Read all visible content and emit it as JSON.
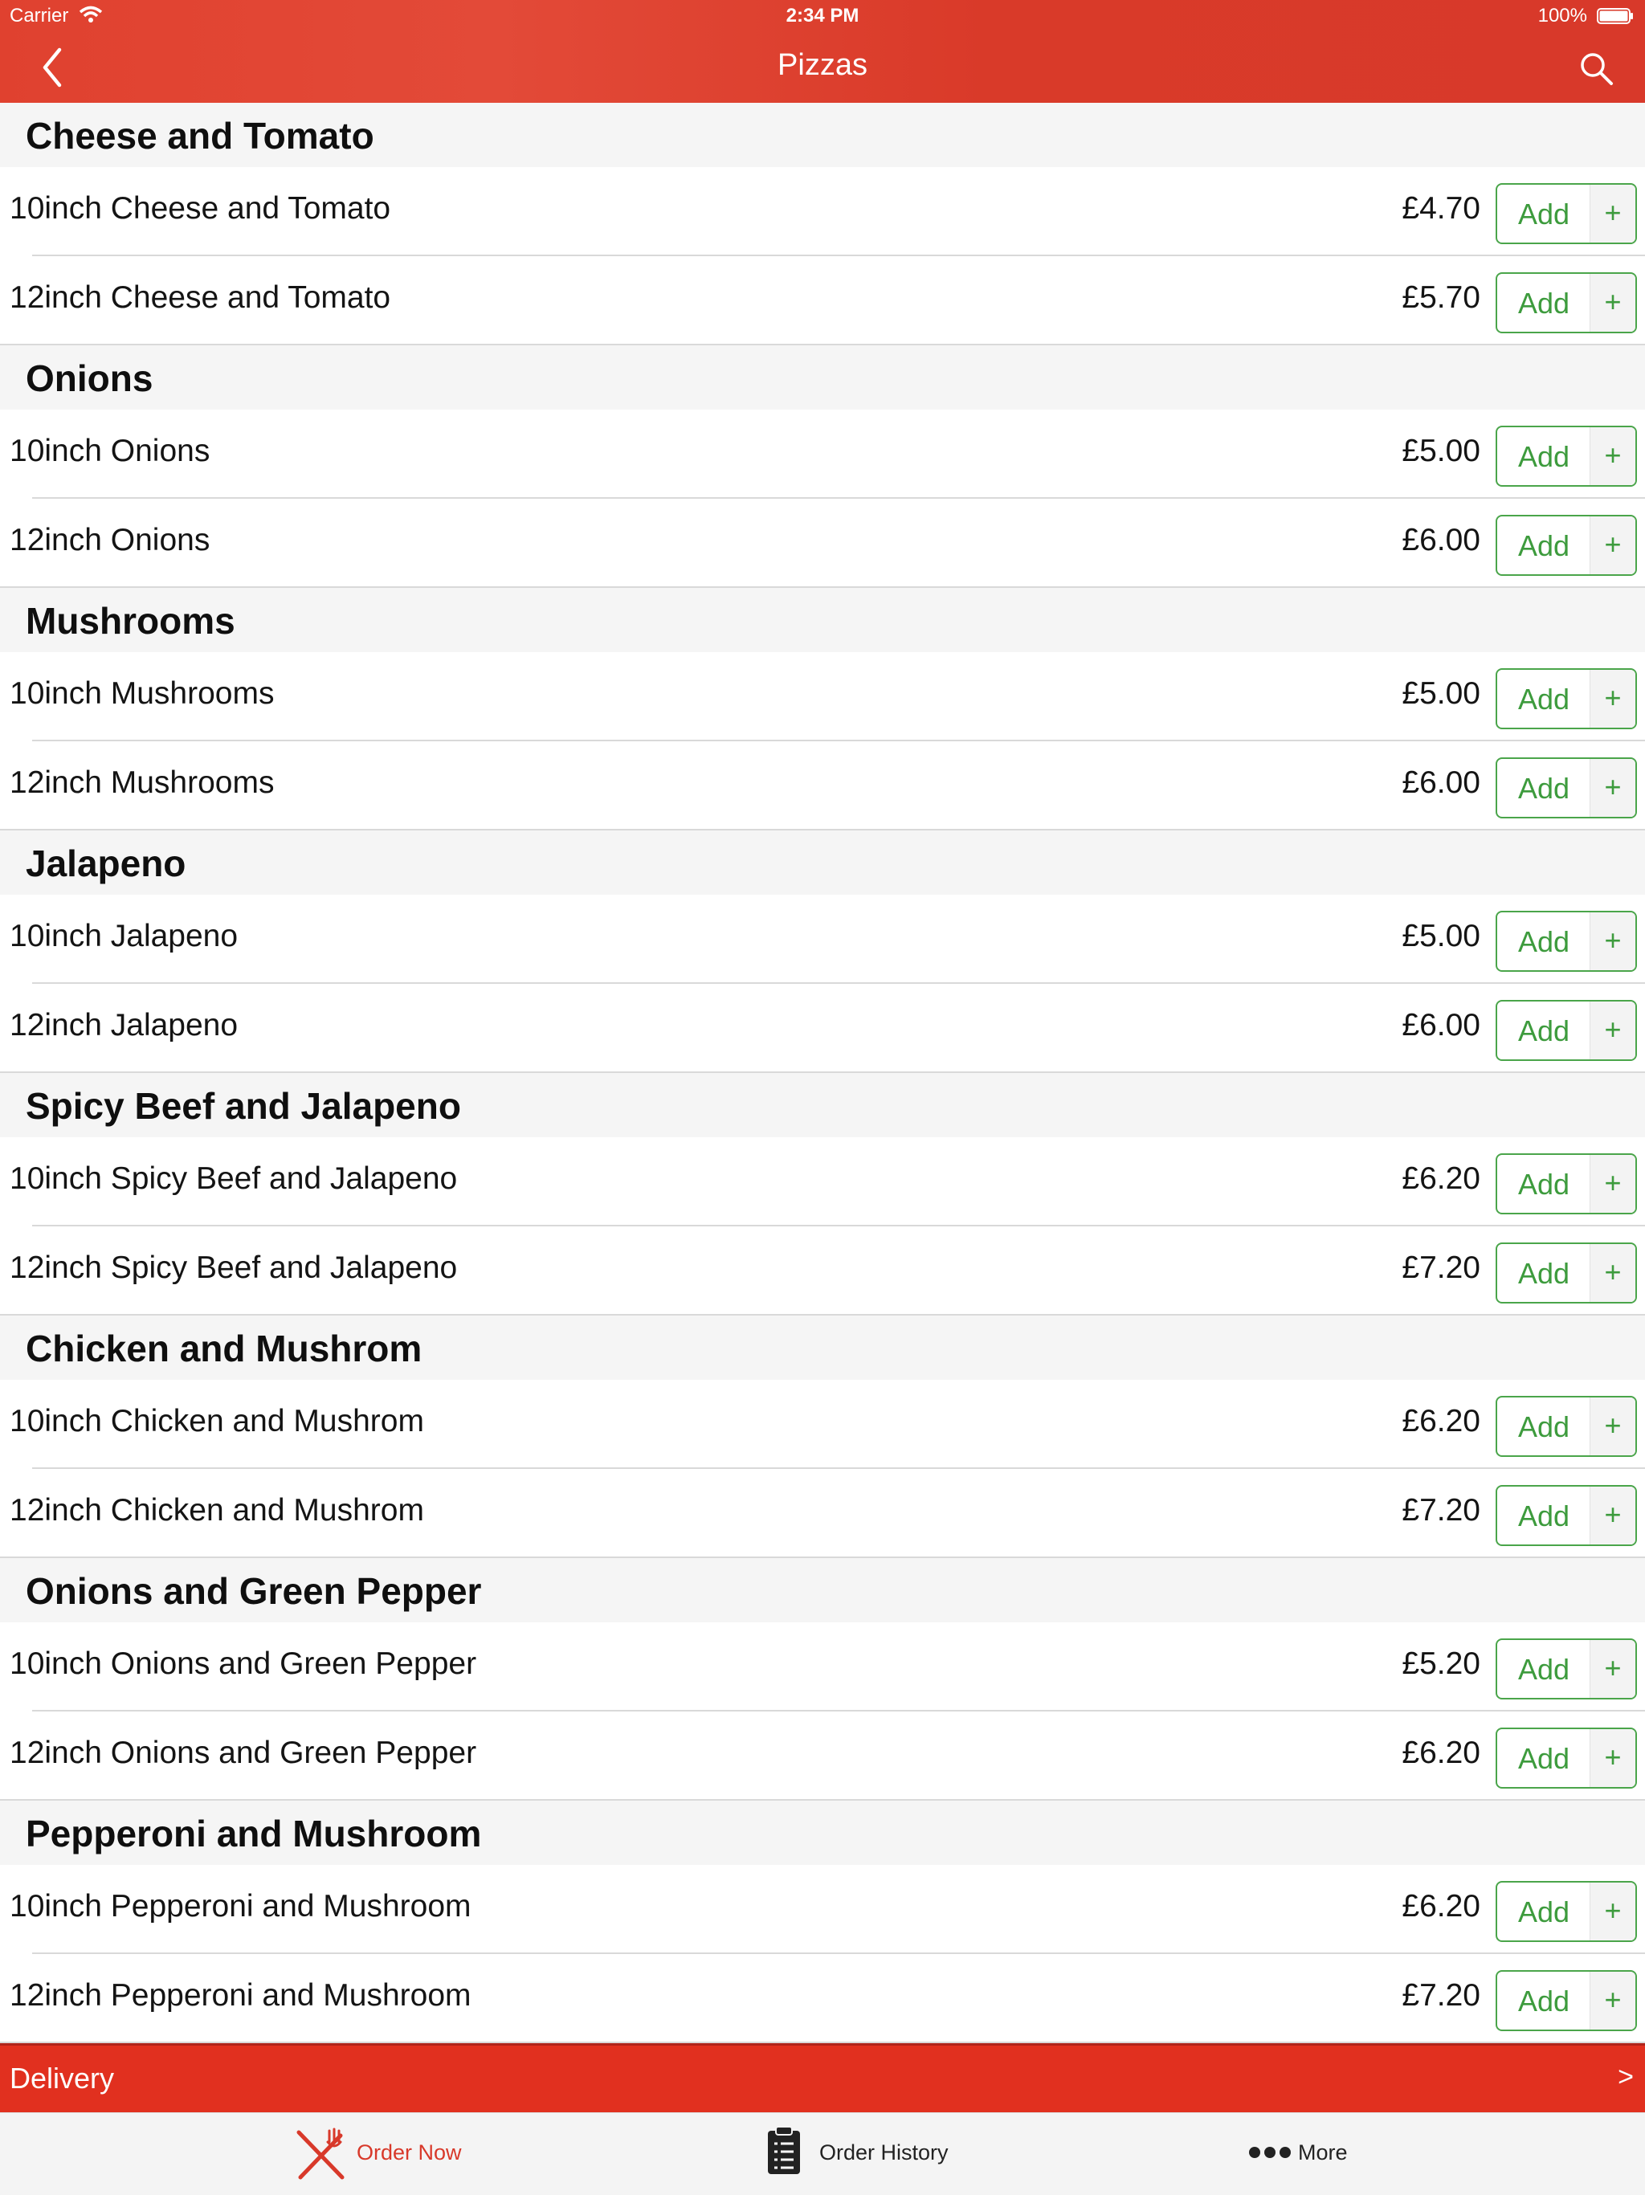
{
  "status_bar": {
    "carrier": "Carrier",
    "time": "2:34 PM",
    "battery": "100%"
  },
  "nav": {
    "title": "Pizzas"
  },
  "sections": [
    {
      "title": "Cheese and Tomato",
      "items": [
        {
          "name": "10inch Cheese and Tomato",
          "price": "£4.70"
        },
        {
          "name": "12inch Cheese and Tomato",
          "price": "£5.70"
        }
      ]
    },
    {
      "title": "Onions",
      "items": [
        {
          "name": "10inch Onions",
          "price": "£5.00"
        },
        {
          "name": "12inch Onions",
          "price": "£6.00"
        }
      ]
    },
    {
      "title": "Mushrooms",
      "items": [
        {
          "name": "10inch Mushrooms",
          "price": "£5.00"
        },
        {
          "name": "12inch Mushrooms",
          "price": "£6.00"
        }
      ]
    },
    {
      "title": "Jalapeno",
      "items": [
        {
          "name": "10inch Jalapeno",
          "price": "£5.00"
        },
        {
          "name": "12inch Jalapeno",
          "price": "£6.00"
        }
      ]
    },
    {
      "title": "Spicy Beef and Jalapeno",
      "items": [
        {
          "name": "10inch Spicy Beef and Jalapeno",
          "price": "£6.20"
        },
        {
          "name": "12inch Spicy Beef and Jalapeno",
          "price": "£7.20"
        }
      ]
    },
    {
      "title": "Chicken and Mushrom",
      "items": [
        {
          "name": "10inch Chicken and Mushrom",
          "price": "£6.20"
        },
        {
          "name": "12inch Chicken and Mushrom",
          "price": "£7.20"
        }
      ]
    },
    {
      "title": "Onions and Green Pepper",
      "items": [
        {
          "name": "10inch Onions and Green Pepper",
          "price": "£5.20"
        },
        {
          "name": "12inch Onions and Green Pepper",
          "price": "£6.20"
        }
      ]
    },
    {
      "title": "Pepperoni and Mushroom",
      "items": [
        {
          "name": "10inch Pepperoni and Mushroom",
          "price": "£6.20"
        },
        {
          "name": "12inch Pepperoni and Mushroom",
          "price": "£7.20"
        }
      ]
    }
  ],
  "add_button": {
    "label": "Add",
    "plus": "+"
  },
  "delivery_bar": {
    "label": "Delivery",
    "chevron": ">"
  },
  "tabs": [
    {
      "label": "Order Now",
      "icon": "fork-knife-icon",
      "active": true
    },
    {
      "label": "Order History",
      "icon": "clipboard-icon",
      "active": false
    },
    {
      "label": "More",
      "icon": "more-dots-icon",
      "active": false
    }
  ],
  "colors": {
    "brand_red": "#e0412f",
    "add_green": "#3d9b3d",
    "section_bg": "#f5f5f5"
  }
}
